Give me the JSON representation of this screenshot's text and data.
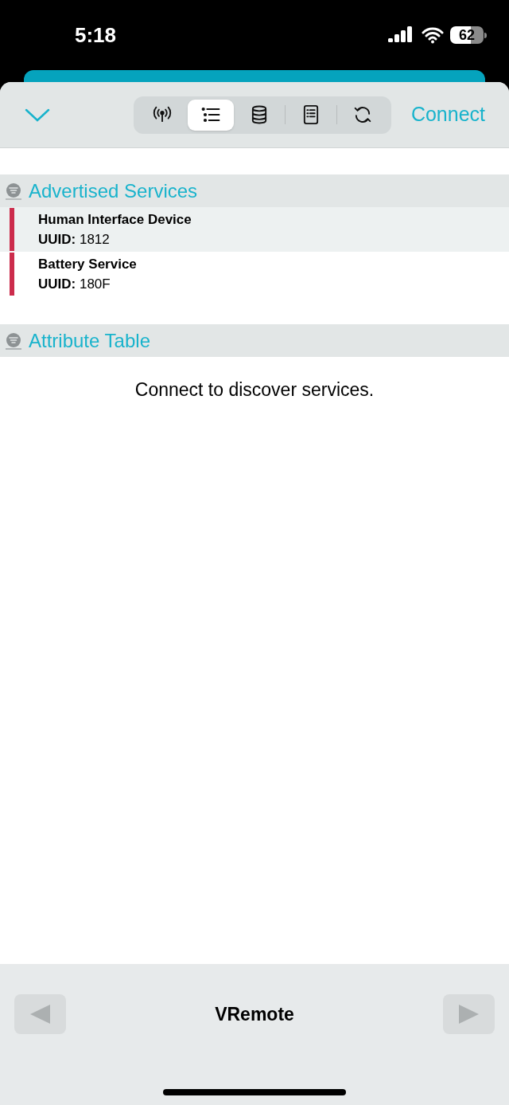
{
  "status_bar": {
    "time": "5:18",
    "battery": "62"
  },
  "toolbar": {
    "connect_label": "Connect",
    "tabs": [
      {
        "kind": "antenna",
        "selected": false
      },
      {
        "kind": "list",
        "selected": true
      },
      {
        "kind": "database",
        "selected": false
      },
      {
        "kind": "document",
        "selected": false
      },
      {
        "kind": "refresh",
        "selected": false
      }
    ]
  },
  "sections": [
    {
      "title": "Advertised Services",
      "services": [
        {
          "name": "Human Interface Device",
          "uuid": "**UUID:** 1812",
          "selected": true
        },
        {
          "name": "Battery Service",
          "uuid": "**UUID:** 180F",
          "selected": false
        }
      ]
    },
    {
      "title": "Attribute Table",
      "message": "Connect to discover services."
    }
  ],
  "bottom_bar": {
    "title": "VRemote"
  }
}
